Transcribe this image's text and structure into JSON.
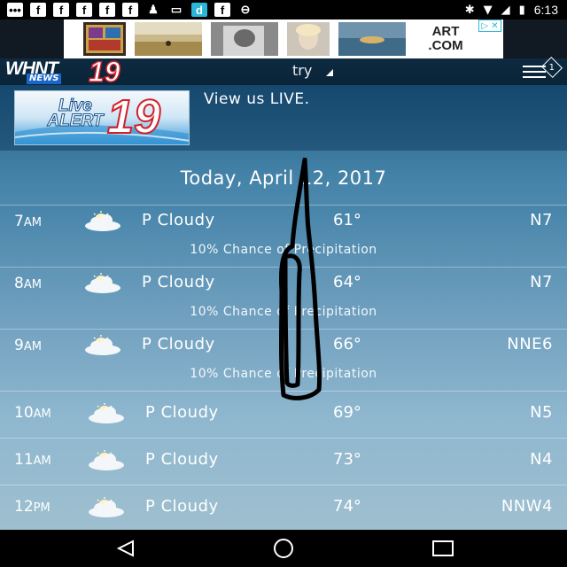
{
  "status_bar": {
    "left_icons": [
      "chat-icon",
      "facebook-icon",
      "facebook-icon",
      "facebook-icon",
      "facebook-icon",
      "facebook-icon",
      "pawn-icon",
      "cast-icon",
      "d-app-icon",
      "facebook-icon",
      "sync-icon"
    ],
    "time": "6:13"
  },
  "ad": {
    "logo_line1": "ART",
    "logo_line2": ".COM"
  },
  "header": {
    "logo_main": "WHNT",
    "logo_sub": "NEWS",
    "logo_number": "19",
    "title": "try",
    "menu_badge": "1"
  },
  "live": {
    "banner_line1": "Live",
    "banner_line2": "ALERT",
    "banner_number": "19",
    "caption": "View us LIVE."
  },
  "date": "Today, April 12, 2017",
  "hours": [
    {
      "hour": "7",
      "suffix": "AM",
      "condition": "P Cloudy",
      "temp": "61°",
      "wind": "N7",
      "precip": "10% Chance of Precipitation"
    },
    {
      "hour": "8",
      "suffix": "AM",
      "condition": "P Cloudy",
      "temp": "64°",
      "wind": "N7",
      "precip": "10% Chance of Precipitation"
    },
    {
      "hour": "9",
      "suffix": "AM",
      "condition": "P Cloudy",
      "temp": "66°",
      "wind": "NNE6",
      "precip": "10% Chance of Precipitation"
    },
    {
      "hour": "10",
      "suffix": "AM",
      "condition": "P Cloudy",
      "temp": "69°",
      "wind": "N5",
      "precip": ""
    },
    {
      "hour": "11",
      "suffix": "AM",
      "condition": "P Cloudy",
      "temp": "73°",
      "wind": "N4",
      "precip": ""
    },
    {
      "hour": "12",
      "suffix": "PM",
      "condition": "P Cloudy",
      "temp": "74°",
      "wind": "NNW4",
      "precip": ""
    }
  ],
  "colors": {
    "brand_red": "#d3202a",
    "brand_blue": "#1b66c9",
    "header_bg": "#0d2a40"
  }
}
